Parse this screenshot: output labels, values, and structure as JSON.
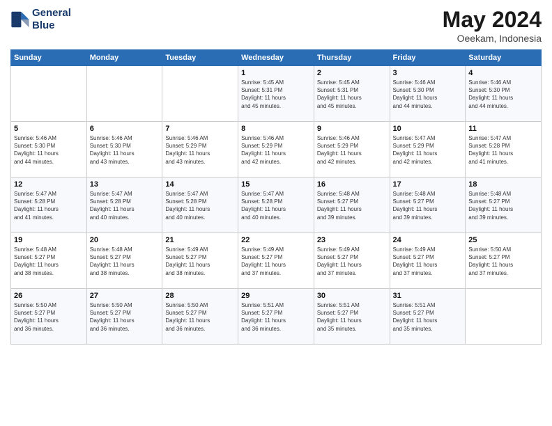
{
  "header": {
    "logo_line1": "General",
    "logo_line2": "Blue",
    "month_title": "May 2024",
    "location": "Oeekam, Indonesia"
  },
  "days_of_week": [
    "Sunday",
    "Monday",
    "Tuesday",
    "Wednesday",
    "Thursday",
    "Friday",
    "Saturday"
  ],
  "weeks": [
    [
      {
        "day": "",
        "sunrise": "",
        "sunset": "",
        "daylight": ""
      },
      {
        "day": "",
        "sunrise": "",
        "sunset": "",
        "daylight": ""
      },
      {
        "day": "",
        "sunrise": "",
        "sunset": "",
        "daylight": ""
      },
      {
        "day": "1",
        "sunrise": "Sunrise: 5:45 AM",
        "sunset": "Sunset: 5:31 PM",
        "daylight": "Daylight: 11 hours and 45 minutes."
      },
      {
        "day": "2",
        "sunrise": "Sunrise: 5:45 AM",
        "sunset": "Sunset: 5:31 PM",
        "daylight": "Daylight: 11 hours and 45 minutes."
      },
      {
        "day": "3",
        "sunrise": "Sunrise: 5:46 AM",
        "sunset": "Sunset: 5:30 PM",
        "daylight": "Daylight: 11 hours and 44 minutes."
      },
      {
        "day": "4",
        "sunrise": "Sunrise: 5:46 AM",
        "sunset": "Sunset: 5:30 PM",
        "daylight": "Daylight: 11 hours and 44 minutes."
      }
    ],
    [
      {
        "day": "5",
        "sunrise": "Sunrise: 5:46 AM",
        "sunset": "Sunset: 5:30 PM",
        "daylight": "Daylight: 11 hours and 44 minutes."
      },
      {
        "day": "6",
        "sunrise": "Sunrise: 5:46 AM",
        "sunset": "Sunset: 5:30 PM",
        "daylight": "Daylight: 11 hours and 43 minutes."
      },
      {
        "day": "7",
        "sunrise": "Sunrise: 5:46 AM",
        "sunset": "Sunset: 5:29 PM",
        "daylight": "Daylight: 11 hours and 43 minutes."
      },
      {
        "day": "8",
        "sunrise": "Sunrise: 5:46 AM",
        "sunset": "Sunset: 5:29 PM",
        "daylight": "Daylight: 11 hours and 42 minutes."
      },
      {
        "day": "9",
        "sunrise": "Sunrise: 5:46 AM",
        "sunset": "Sunset: 5:29 PM",
        "daylight": "Daylight: 11 hours and 42 minutes."
      },
      {
        "day": "10",
        "sunrise": "Sunrise: 5:47 AM",
        "sunset": "Sunset: 5:29 PM",
        "daylight": "Daylight: 11 hours and 42 minutes."
      },
      {
        "day": "11",
        "sunrise": "Sunrise: 5:47 AM",
        "sunset": "Sunset: 5:28 PM",
        "daylight": "Daylight: 11 hours and 41 minutes."
      }
    ],
    [
      {
        "day": "12",
        "sunrise": "Sunrise: 5:47 AM",
        "sunset": "Sunset: 5:28 PM",
        "daylight": "Daylight: 11 hours and 41 minutes."
      },
      {
        "day": "13",
        "sunrise": "Sunrise: 5:47 AM",
        "sunset": "Sunset: 5:28 PM",
        "daylight": "Daylight: 11 hours and 40 minutes."
      },
      {
        "day": "14",
        "sunrise": "Sunrise: 5:47 AM",
        "sunset": "Sunset: 5:28 PM",
        "daylight": "Daylight: 11 hours and 40 minutes."
      },
      {
        "day": "15",
        "sunrise": "Sunrise: 5:47 AM",
        "sunset": "Sunset: 5:28 PM",
        "daylight": "Daylight: 11 hours and 40 minutes."
      },
      {
        "day": "16",
        "sunrise": "Sunrise: 5:48 AM",
        "sunset": "Sunset: 5:27 PM",
        "daylight": "Daylight: 11 hours and 39 minutes."
      },
      {
        "day": "17",
        "sunrise": "Sunrise: 5:48 AM",
        "sunset": "Sunset: 5:27 PM",
        "daylight": "Daylight: 11 hours and 39 minutes."
      },
      {
        "day": "18",
        "sunrise": "Sunrise: 5:48 AM",
        "sunset": "Sunset: 5:27 PM",
        "daylight": "Daylight: 11 hours and 39 minutes."
      }
    ],
    [
      {
        "day": "19",
        "sunrise": "Sunrise: 5:48 AM",
        "sunset": "Sunset: 5:27 PM",
        "daylight": "Daylight: 11 hours and 38 minutes."
      },
      {
        "day": "20",
        "sunrise": "Sunrise: 5:48 AM",
        "sunset": "Sunset: 5:27 PM",
        "daylight": "Daylight: 11 hours and 38 minutes."
      },
      {
        "day": "21",
        "sunrise": "Sunrise: 5:49 AM",
        "sunset": "Sunset: 5:27 PM",
        "daylight": "Daylight: 11 hours and 38 minutes."
      },
      {
        "day": "22",
        "sunrise": "Sunrise: 5:49 AM",
        "sunset": "Sunset: 5:27 PM",
        "daylight": "Daylight: 11 hours and 37 minutes."
      },
      {
        "day": "23",
        "sunrise": "Sunrise: 5:49 AM",
        "sunset": "Sunset: 5:27 PM",
        "daylight": "Daylight: 11 hours and 37 minutes."
      },
      {
        "day": "24",
        "sunrise": "Sunrise: 5:49 AM",
        "sunset": "Sunset: 5:27 PM",
        "daylight": "Daylight: 11 hours and 37 minutes."
      },
      {
        "day": "25",
        "sunrise": "Sunrise: 5:50 AM",
        "sunset": "Sunset: 5:27 PM",
        "daylight": "Daylight: 11 hours and 37 minutes."
      }
    ],
    [
      {
        "day": "26",
        "sunrise": "Sunrise: 5:50 AM",
        "sunset": "Sunset: 5:27 PM",
        "daylight": "Daylight: 11 hours and 36 minutes."
      },
      {
        "day": "27",
        "sunrise": "Sunrise: 5:50 AM",
        "sunset": "Sunset: 5:27 PM",
        "daylight": "Daylight: 11 hours and 36 minutes."
      },
      {
        "day": "28",
        "sunrise": "Sunrise: 5:50 AM",
        "sunset": "Sunset: 5:27 PM",
        "daylight": "Daylight: 11 hours and 36 minutes."
      },
      {
        "day": "29",
        "sunrise": "Sunrise: 5:51 AM",
        "sunset": "Sunset: 5:27 PM",
        "daylight": "Daylight: 11 hours and 36 minutes."
      },
      {
        "day": "30",
        "sunrise": "Sunrise: 5:51 AM",
        "sunset": "Sunset: 5:27 PM",
        "daylight": "Daylight: 11 hours and 35 minutes."
      },
      {
        "day": "31",
        "sunrise": "Sunrise: 5:51 AM",
        "sunset": "Sunset: 5:27 PM",
        "daylight": "Daylight: 11 hours and 35 minutes."
      },
      {
        "day": "",
        "sunrise": "",
        "sunset": "",
        "daylight": ""
      }
    ]
  ]
}
